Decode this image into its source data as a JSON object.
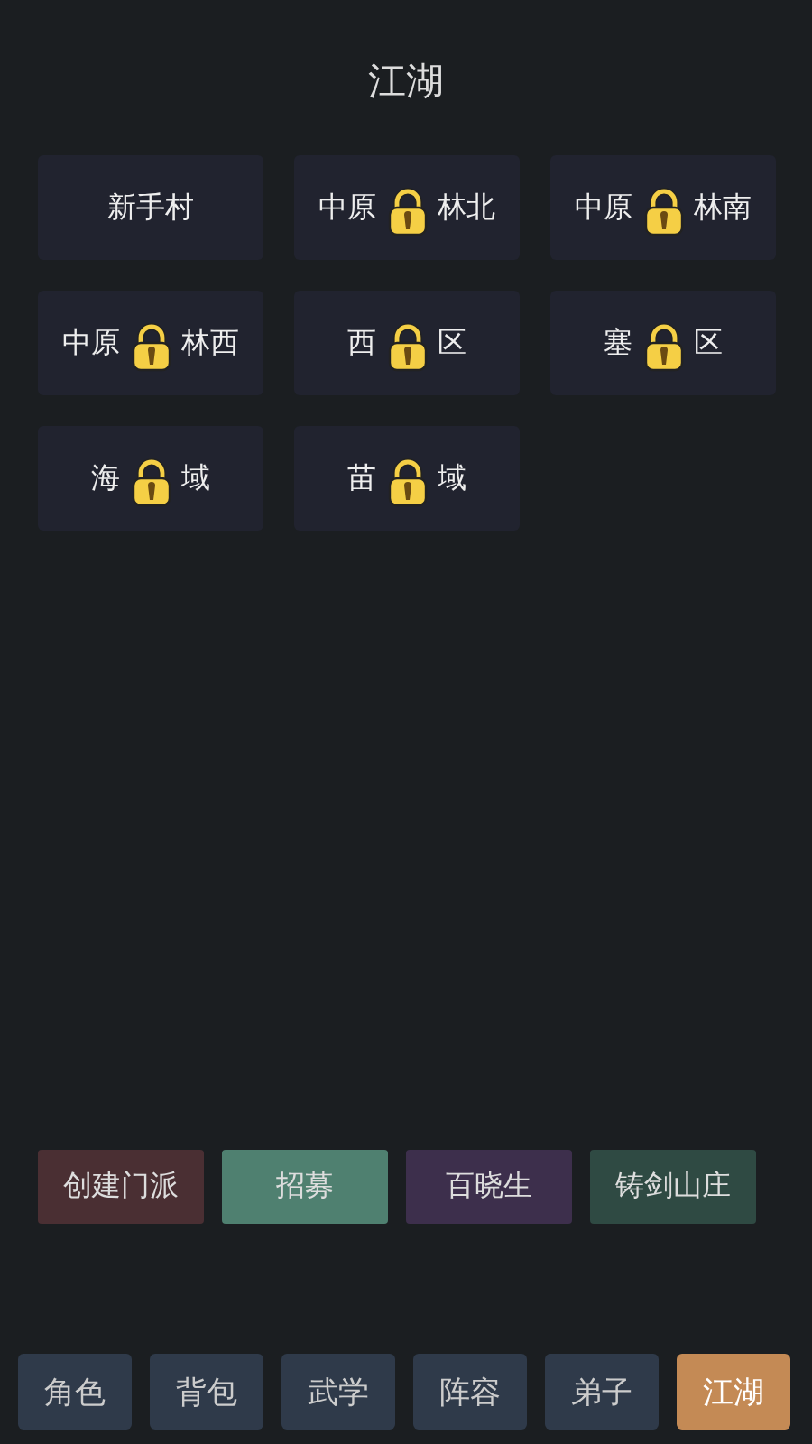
{
  "title": "江湖",
  "regions": [
    {
      "name": "新手村",
      "locked": false
    },
    {
      "name_left": "中原",
      "name_right": "林北",
      "locked": true
    },
    {
      "name_left": "中原",
      "name_right": "林南",
      "locked": true
    },
    {
      "name_left": "中原",
      "name_right": "林西",
      "locked": true
    },
    {
      "name_left": "西",
      "name_right": "区",
      "locked": true
    },
    {
      "name_left": "塞",
      "name_right": "区",
      "locked": true
    },
    {
      "name_left": "海",
      "name_right": "域",
      "locked": true
    },
    {
      "name_left": "苗",
      "name_right": "域",
      "locked": true
    }
  ],
  "actions": [
    {
      "label": "创建门派",
      "color": "#4a2f33"
    },
    {
      "label": "招募",
      "color": "#4f8070"
    },
    {
      "label": "百晓生",
      "color": "#3d2f4c"
    },
    {
      "label": "铸剑山庄",
      "color": "#2f4a43"
    }
  ],
  "nav": [
    {
      "label": "角色",
      "selected": false
    },
    {
      "label": "背包",
      "selected": false
    },
    {
      "label": "武学",
      "selected": false
    },
    {
      "label": "阵容",
      "selected": false
    },
    {
      "label": "弟子",
      "selected": false
    },
    {
      "label": "江湖",
      "selected": true
    }
  ]
}
